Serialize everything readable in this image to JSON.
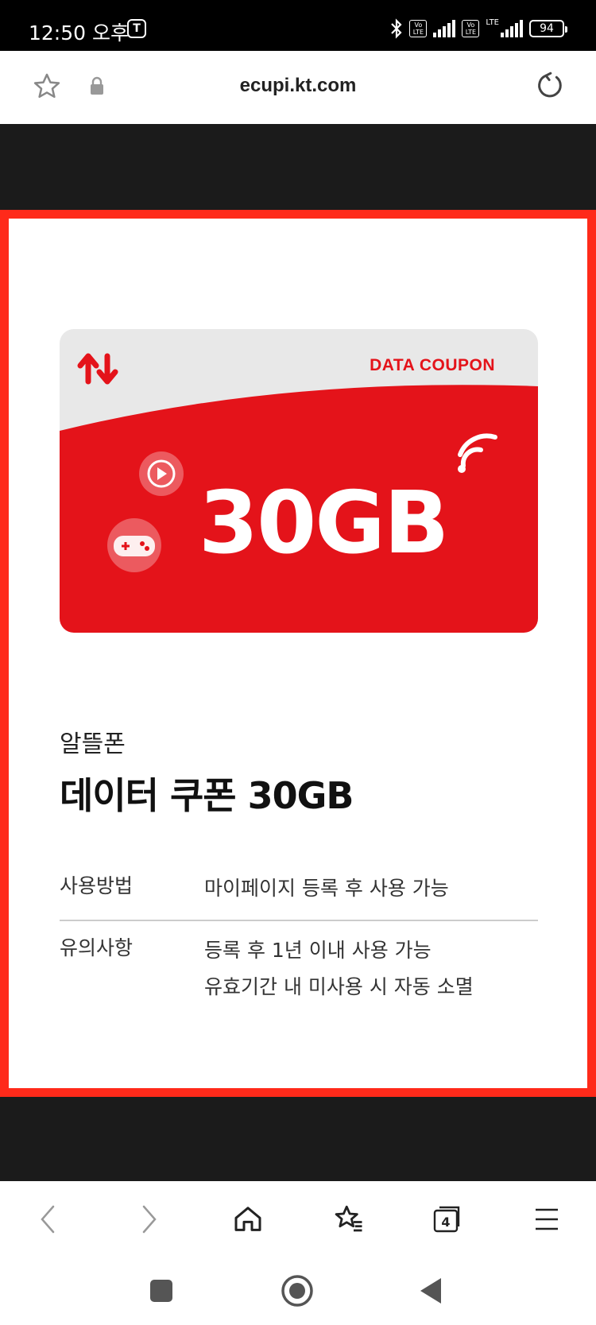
{
  "status_bar": {
    "time": "12:50 오후",
    "t_badge": "T",
    "volte1": "Vo LTE",
    "volte2": "Vo LTE",
    "lte": "LTE",
    "battery": "94"
  },
  "browser": {
    "url": "ecupi.kt.com",
    "tabs_count": "4"
  },
  "coupon": {
    "label": "DATA COUPON",
    "amount": "30GB",
    "accent_color": "#e4131a"
  },
  "product": {
    "brand": "알뜰폰",
    "title": "데이터 쿠폰 30GB"
  },
  "info": [
    {
      "key": "사용방법",
      "lines": [
        "마이페이지 등록 후 사용 가능"
      ]
    },
    {
      "key": "유의사항",
      "lines": [
        "등록 후 1년 이내 사용 가능",
        "유효기간 내 미사용 시 자동 소멸"
      ]
    }
  ],
  "icons": {
    "url_bar": [
      "star-icon",
      "lock-icon",
      "reload-icon"
    ],
    "nav": [
      "back-icon",
      "forward-icon",
      "home-icon",
      "bookmarks-icon",
      "tabs-icon",
      "menu-icon"
    ],
    "system": [
      "recents-icon",
      "home-circle-icon",
      "back-triangle-icon"
    ]
  }
}
